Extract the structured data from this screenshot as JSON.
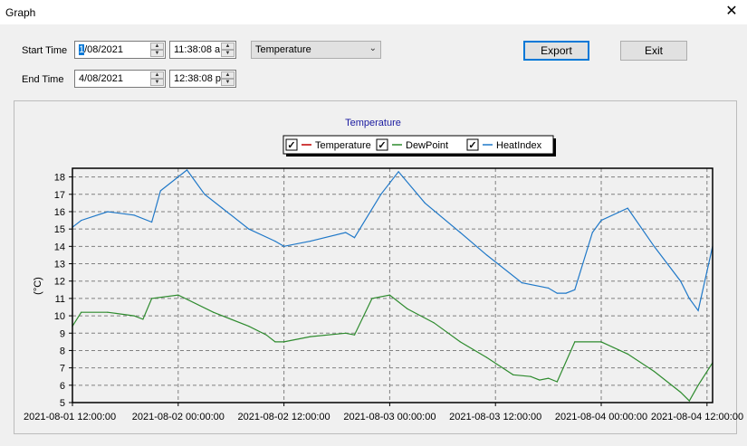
{
  "window": {
    "title": "Graph"
  },
  "controls": {
    "start_label": "Start Time",
    "start_date_sel": "1",
    "start_date_rest": "/08/2021",
    "start_time": "11:38:08 a",
    "end_label": "End Time",
    "end_date": "4/08/2021",
    "end_time": "12:38:08 p",
    "measure": "Temperature",
    "export_label": "Export",
    "exit_label": "Exit"
  },
  "chart_data": {
    "type": "line",
    "title": "Temperature",
    "ylabel": "(°C)",
    "xlabel": "",
    "ylim": [
      5,
      18.5
    ],
    "yticks": [
      5,
      6,
      7,
      8,
      9,
      10,
      11,
      12,
      13,
      14,
      15,
      16,
      17,
      18
    ],
    "xlim": [
      "2021-08-01 12:00:00",
      "2021-08-04 12:38:08"
    ],
    "xticks": [
      "2021-08-01 12:00:00",
      "2021-08-02 00:00:00",
      "2021-08-02 12:00:00",
      "2021-08-03 00:00:00",
      "2021-08-03 12:00:00",
      "2021-08-04 00:00:00",
      "2021-08-04 12:00:00"
    ],
    "grid": true,
    "legend": "top-center",
    "series": [
      {
        "name": "Temperature",
        "color": "#c00000",
        "checked": true,
        "x": [],
        "y": []
      },
      {
        "name": "HeatIndex",
        "color": "#1f78c8",
        "checked": true,
        "x": [
          "2021-08-01 12:00:00",
          "2021-08-01 13:00:00",
          "2021-08-01 16:00:00",
          "2021-08-01 19:00:00",
          "2021-08-01 21:00:00",
          "2021-08-01 22:00:00",
          "2021-08-02 01:00:00",
          "2021-08-02 03:00:00",
          "2021-08-02 05:00:00",
          "2021-08-02 08:00:00",
          "2021-08-02 11:00:00",
          "2021-08-02 12:00:00",
          "2021-08-02 15:00:00",
          "2021-08-02 19:00:00",
          "2021-08-02 20:00:00",
          "2021-08-02 23:00:00",
          "2021-08-03 01:00:00",
          "2021-08-03 04:00:00",
          "2021-08-03 08:00:00",
          "2021-08-03 11:00:00",
          "2021-08-03 15:00:00",
          "2021-08-03 18:00:00",
          "2021-08-03 19:00:00",
          "2021-08-03 20:00:00",
          "2021-08-03 21:00:00",
          "2021-08-03 23:00:00",
          "2021-08-04 00:00:00",
          "2021-08-04 03:00:00",
          "2021-08-04 06:00:00",
          "2021-08-04 09:00:00",
          "2021-08-04 10:00:00",
          "2021-08-04 11:00:00",
          "2021-08-04 12:38:00"
        ],
        "y": [
          15.1,
          15.5,
          16.0,
          15.8,
          15.4,
          17.2,
          18.4,
          17.0,
          16.2,
          15.0,
          14.3,
          14.0,
          14.3,
          14.8,
          14.5,
          17.0,
          18.3,
          16.5,
          14.8,
          13.5,
          11.9,
          11.6,
          11.3,
          11.3,
          11.5,
          14.8,
          15.5,
          16.2,
          14.0,
          12.0,
          11.0,
          10.3,
          14.0
        ]
      },
      {
        "name": "DewPoint",
        "color": "#2e8b2e",
        "checked": true,
        "x": [
          "2021-08-01 12:00:00",
          "2021-08-01 13:00:00",
          "2021-08-01 16:00:00",
          "2021-08-01 19:00:00",
          "2021-08-01 20:00:00",
          "2021-08-01 21:00:00",
          "2021-08-02 00:00:00",
          "2021-08-02 04:00:00",
          "2021-08-02 08:00:00",
          "2021-08-02 10:00:00",
          "2021-08-02 11:00:00",
          "2021-08-02 12:00:00",
          "2021-08-02 15:00:00",
          "2021-08-02 19:00:00",
          "2021-08-02 20:00:00",
          "2021-08-02 22:00:00",
          "2021-08-03 00:00:00",
          "2021-08-03 02:00:00",
          "2021-08-03 05:00:00",
          "2021-08-03 08:00:00",
          "2021-08-03 11:00:00",
          "2021-08-03 14:00:00",
          "2021-08-03 16:00:00",
          "2021-08-03 17:00:00",
          "2021-08-03 18:00:00",
          "2021-08-03 19:00:00",
          "2021-08-03 21:00:00",
          "2021-08-04 00:00:00",
          "2021-08-04 03:00:00",
          "2021-08-04 06:00:00",
          "2021-08-04 09:00:00",
          "2021-08-04 10:00:00",
          "2021-08-04 11:00:00",
          "2021-08-04 12:38:00"
        ],
        "y": [
          9.4,
          10.2,
          10.2,
          10.0,
          9.8,
          11.0,
          11.2,
          10.2,
          9.4,
          8.9,
          8.5,
          8.5,
          8.8,
          9.0,
          8.9,
          11.0,
          11.2,
          10.4,
          9.6,
          8.5,
          7.6,
          6.6,
          6.5,
          6.3,
          6.4,
          6.2,
          8.5,
          8.5,
          7.8,
          6.8,
          5.6,
          5.1,
          6.0,
          7.3
        ]
      }
    ]
  }
}
